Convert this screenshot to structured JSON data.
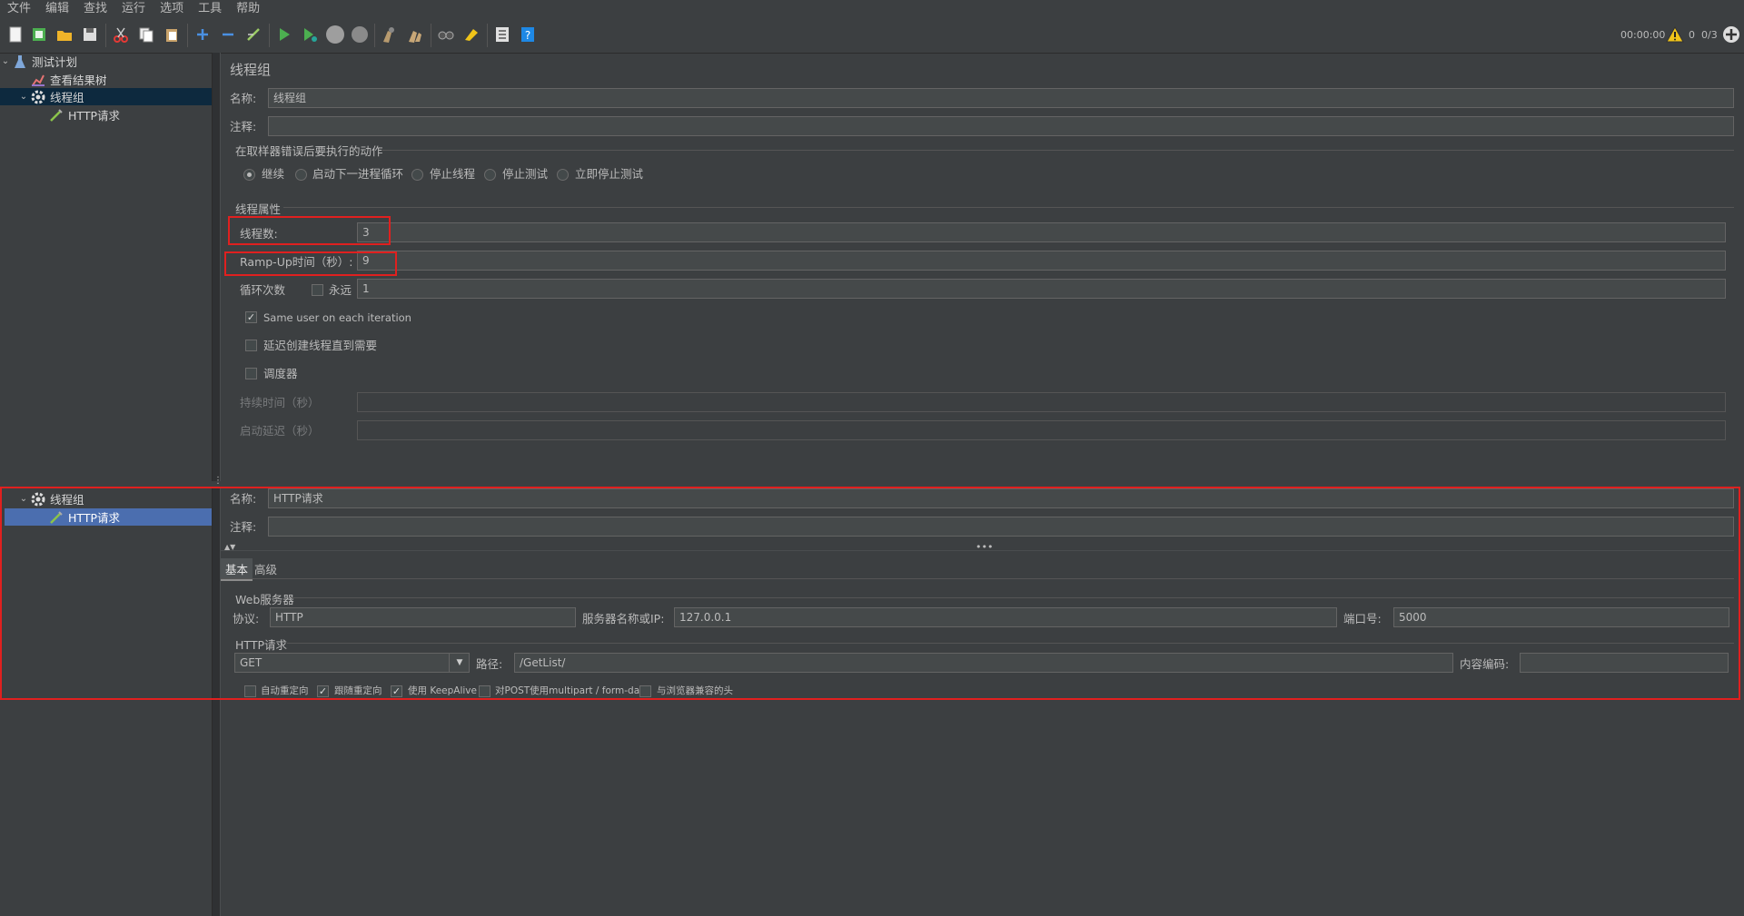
{
  "menu": [
    "文件",
    "编辑",
    "查找",
    "运行",
    "选项",
    "工具",
    "帮助"
  ],
  "toolbar_icons": [
    "new-icon",
    "templates-icon",
    "open-icon",
    "save-icon",
    "cut-icon",
    "copy-icon",
    "paste-icon",
    "expand-icon",
    "collapse-icon",
    "toggle-icon",
    "start-icon",
    "start-no-pause-icon",
    "stop-icon",
    "shutdown-icon",
    "clear-icon",
    "clear-all-icon",
    "search-icon",
    "reset-search-icon",
    "function-helper-icon",
    "help-icon"
  ],
  "status": {
    "timer": "00:00:00",
    "warnings": "0",
    "threads": "0/3"
  },
  "tree_top": {
    "items": [
      {
        "label": "测试计划",
        "icon": "flask-icon"
      },
      {
        "label": "查看结果树",
        "icon": "chart-icon"
      },
      {
        "label": "线程组",
        "icon": "gear-icon"
      },
      {
        "label": "HTTP请求",
        "icon": "pipette-icon"
      }
    ]
  },
  "tree_bottom": {
    "items": [
      {
        "label": "线程组",
        "icon": "gear-icon"
      },
      {
        "label": "HTTP请求",
        "icon": "pipette-icon"
      }
    ]
  },
  "thread_group": {
    "title": "线程组",
    "name_label": "名称:",
    "name_value": "线程组",
    "comment_label": "注释:",
    "comment_value": "",
    "error_action_title": "在取样器错误后要执行的动作",
    "error_actions": [
      "继续",
      "启动下一进程循环",
      "停止线程",
      "停止测试",
      "立即停止测试"
    ],
    "error_action_selected": "继续",
    "props_title": "线程属性",
    "threads_label": "线程数:",
    "threads_value": "3",
    "rampup_label": "Ramp-Up时间（秒）:",
    "rampup_value": "9",
    "loop_label": "循环次数",
    "forever_label": "永远",
    "loop_value": "1",
    "same_user_label": "Same user on each iteration",
    "same_user_checked": true,
    "delay_label": "延迟创建线程直到需要",
    "delay_checked": false,
    "scheduler_label": "调度器",
    "scheduler_checked": false,
    "duration_label": "持续时间（秒）",
    "startup_delay_label": "启动延迟（秒）"
  },
  "http_request": {
    "name_label": "名称:",
    "name_value": "HTTP请求",
    "comment_label": "注释:",
    "comment_value": "",
    "tabs": [
      "基本",
      "高级"
    ],
    "web_server_title": "Web服务器",
    "protocol_label": "协议:",
    "protocol_value": "HTTP",
    "server_label": "服务器名称或IP:",
    "server_value": "127.0.0.1",
    "port_label": "端口号:",
    "port_value": "5000",
    "http_title": "HTTP请求",
    "method_value": "GET",
    "path_label": "路径:",
    "path_value": "/GetList/",
    "encoding_label": "内容编码:",
    "encoding_value": "",
    "options": [
      {
        "label": "自动重定向",
        "checked": false
      },
      {
        "label": "跟随重定向",
        "checked": true
      },
      {
        "label": "使用 KeepAlive",
        "checked": true
      },
      {
        "label": "对POST使用multipart / form-data",
        "checked": false
      },
      {
        "label": "与浏览器兼容的头",
        "checked": false
      }
    ]
  }
}
